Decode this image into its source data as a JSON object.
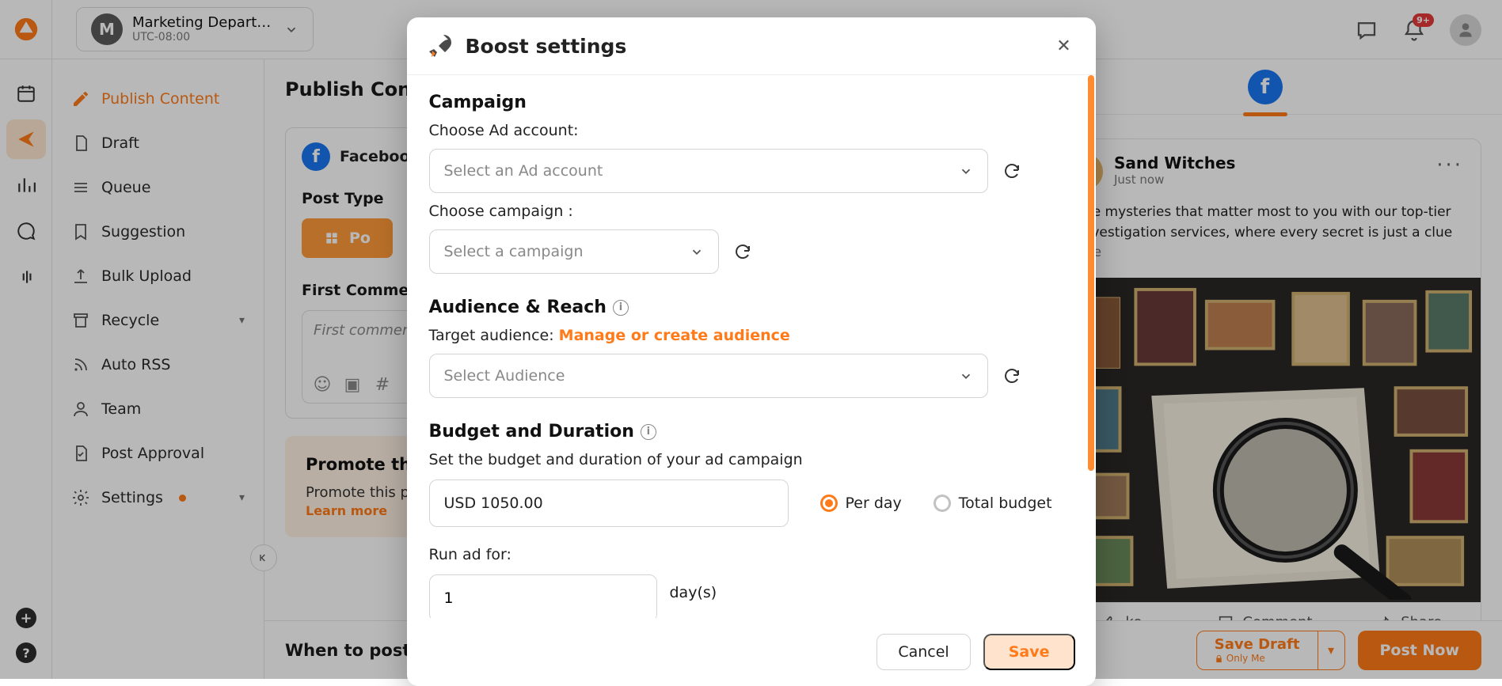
{
  "workspace": {
    "avatar": "M",
    "name": "Marketing Departm…",
    "tz": "UTC-08:00"
  },
  "notifications": {
    "count": "9+"
  },
  "sidebar": {
    "items": [
      {
        "label": "Publish Content"
      },
      {
        "label": "Draft"
      },
      {
        "label": "Queue"
      },
      {
        "label": "Suggestion"
      },
      {
        "label": "Bulk Upload"
      },
      {
        "label": "Recycle"
      },
      {
        "label": "Auto RSS"
      },
      {
        "label": "Team"
      },
      {
        "label": "Post Approval"
      },
      {
        "label": "Settings"
      }
    ]
  },
  "header": {
    "title": "Publish Content"
  },
  "composer": {
    "fb_options": "Facebook Op",
    "post_type_label": "Post Type",
    "post_type_btn": "Po",
    "first_comment_label": "First Comment",
    "first_comment_placeholder": "First comment wi"
  },
  "promote_card": {
    "title": "Promote this post",
    "body": "Promote this post b\npublish your post, F",
    "learn_more": "Learn more"
  },
  "footer": {
    "when_label": "When to post",
    "save_draft": "Save Draft",
    "only_me": "Only Me",
    "post_now": "Post Now"
  },
  "preview": {
    "name": "Sand Witches",
    "time": "Just now",
    "body_prefix": "k the mysteries that matter most to you with our top-tier e investigation services, where every secret is just a clue ",
    "see_more": "more",
    "like": "ke",
    "comment": "Comment",
    "share": "Share"
  },
  "modal": {
    "title": "Boost settings",
    "campaign_title": "Campaign",
    "ad_account_label": "Choose Ad account:",
    "ad_account_placeholder": "Select an Ad account",
    "campaign_label": "Choose campaign :",
    "campaign_placeholder": "Select a campaign",
    "audience_title": "Audience & Reach",
    "target_audience_label": "Target audience: ",
    "target_audience_link": "Manage or create audience",
    "audience_placeholder": "Select Audience",
    "budget_title": "Budget and Duration",
    "budget_desc": "Set the budget and duration of your ad campaign",
    "budget_value": "USD 1050.00",
    "per_day": "Per day",
    "total_budget": "Total budget",
    "run_for_label": "Run ad for:",
    "run_for_value": "1",
    "days_suffix": "day(s)",
    "cancel": "Cancel",
    "save": "Save"
  }
}
